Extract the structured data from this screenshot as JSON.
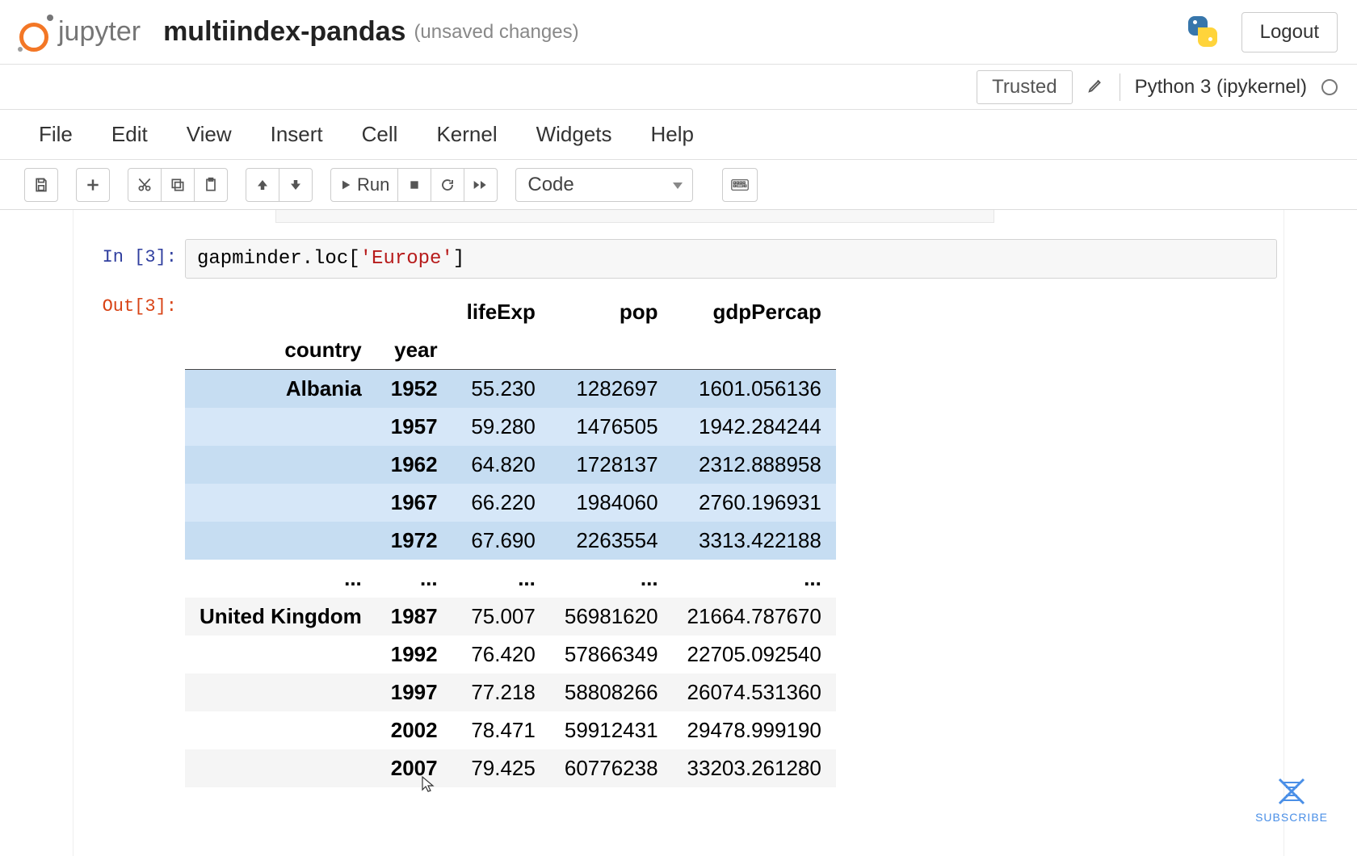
{
  "header": {
    "app_name": "jupyter",
    "doc_title": "multiindex-pandas",
    "doc_status": "(unsaved changes)",
    "logout": "Logout"
  },
  "trust": {
    "trusted": "Trusted",
    "kernel": "Python 3 (ipykernel)"
  },
  "menu": {
    "file": "File",
    "edit": "Edit",
    "view": "View",
    "insert": "Insert",
    "cell": "Cell",
    "kernel": "Kernel",
    "widgets": "Widgets",
    "help": "Help"
  },
  "toolbar": {
    "run": "Run",
    "celltype": "Code"
  },
  "cell": {
    "in_prompt": "In [3]:",
    "out_prompt": "Out[3]:",
    "code_pre": "gapminder.loc[",
    "code_str": "'Europe'",
    "code_post": "]"
  },
  "table": {
    "columns": [
      "lifeExp",
      "pop",
      "gdpPercap"
    ],
    "index_names": [
      "country",
      "year"
    ],
    "rows": [
      {
        "country": "Albania",
        "year": "1952",
        "lifeExp": "55.230",
        "pop": "1282697",
        "gdpPercap": "1601.056136",
        "hl": true,
        "showCountry": true
      },
      {
        "country": "",
        "year": "1957",
        "lifeExp": "59.280",
        "pop": "1476505",
        "gdpPercap": "1942.284244",
        "hl": true
      },
      {
        "country": "",
        "year": "1962",
        "lifeExp": "64.820",
        "pop": "1728137",
        "gdpPercap": "2312.888958",
        "hl": true
      },
      {
        "country": "",
        "year": "1967",
        "lifeExp": "66.220",
        "pop": "1984060",
        "gdpPercap": "2760.196931",
        "hl": true
      },
      {
        "country": "",
        "year": "1972",
        "lifeExp": "67.690",
        "pop": "2263554",
        "gdpPercap": "3313.422188",
        "hl": true
      },
      {
        "ellipsis": true
      },
      {
        "country": "United Kingdom",
        "year": "1987",
        "lifeExp": "75.007",
        "pop": "56981620",
        "gdpPercap": "21664.787670",
        "showCountry": true
      },
      {
        "country": "",
        "year": "1992",
        "lifeExp": "76.420",
        "pop": "57866349",
        "gdpPercap": "22705.092540"
      },
      {
        "country": "",
        "year": "1997",
        "lifeExp": "77.218",
        "pop": "58808266",
        "gdpPercap": "26074.531360"
      },
      {
        "country": "",
        "year": "2002",
        "lifeExp": "78.471",
        "pop": "59912431",
        "gdpPercap": "29478.999190"
      },
      {
        "country": "",
        "year": "2007",
        "lifeExp": "79.425",
        "pop": "60776238",
        "gdpPercap": "33203.261280"
      }
    ]
  },
  "subscribe": "SUBSCRIBE"
}
